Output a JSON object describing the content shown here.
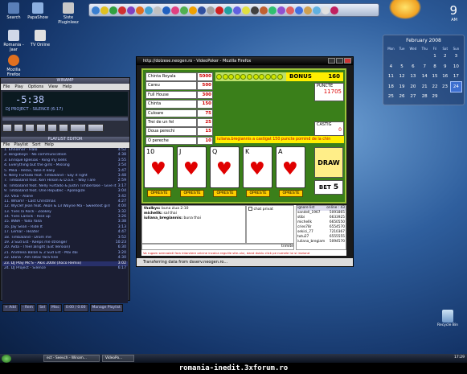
{
  "desktop_icons": [
    {
      "label": "Search",
      "color": "#5a7fb8"
    },
    {
      "label": "PapaShow",
      "color": "#8cb0e0"
    },
    {
      "label": "Siste Pluginleez",
      "color": "#c8c8c8"
    },
    {
      "label": "Romania - Jaar",
      "color": "#d0d8e8"
    },
    {
      "label": "TV Online",
      "color": "#e0e0e0"
    },
    {
      "label": "Mozilla Firefox",
      "color": "#e07020"
    }
  ],
  "clock": {
    "time": "9",
    "ampm": "AM"
  },
  "calendar": {
    "month": "February 2008",
    "days_header": [
      "Mon",
      "Tue",
      "Wed",
      "Thu",
      "Fri",
      "Sat",
      "Sun"
    ],
    "weeks": [
      [
        "",
        "",
        "",
        "",
        "1",
        "2",
        "3"
      ],
      [
        "4",
        "5",
        "6",
        "7",
        "8",
        "9",
        "10"
      ],
      [
        "11",
        "12",
        "13",
        "14",
        "15",
        "16",
        "17"
      ],
      [
        "18",
        "19",
        "20",
        "21",
        "22",
        "23",
        "24"
      ],
      [
        "25",
        "26",
        "27",
        "28",
        "29",
        "",
        ""
      ]
    ],
    "today": "24"
  },
  "winamp": {
    "title": "WINAMP",
    "menu": [
      "File",
      "Play",
      "Options",
      "View",
      "Help"
    ],
    "time": "-5:38",
    "song": "DJ PROJECT - SILENCE (6:17)",
    "playlist_title": "PLAYLIST EDITOR",
    "playlist_menu": [
      "File",
      "Playlist",
      "Sort",
      "Help"
    ],
    "tracks": [
      {
        "title": "1. Ehnomor - Halo",
        "dur": "4:52"
      },
      {
        "title": "2. Bingoboys - No communication",
        "dur": "4:38"
      },
      {
        "title": "3. Enrique Iglesias - Ring my bells",
        "dur": "3:55"
      },
      {
        "title": "4. Everything but the girls - Missing",
        "dur": "3:54"
      },
      {
        "title": "5. Mika - Relax, take it easy",
        "dur": "3:47"
      },
      {
        "title": "6. Nelly Furtado feat. Timbaland - Say it right",
        "dur": "3:48"
      },
      {
        "title": "7. Timbaland feat. Keri Hilson & D.o.e. - Way I are",
        "dur": "2:59"
      },
      {
        "title": "8. Timbaland feat. Nelly Furtado & Justin Timberlake - Give it...",
        "dur": "3:17"
      },
      {
        "title": "9. Timbaland feat. One Republic - Apologize",
        "dur": "3:04"
      },
      {
        "title": "10. Vika - Alane",
        "dur": "3:42"
      },
      {
        "title": "11. Wham! - Last Christmas",
        "dur": "4:27"
      },
      {
        "title": "12. Wyclef Jean feat. Akon & Lil Wayne Ma - Sweetest girl",
        "dur": "4:00"
      },
      {
        "title": "13. Yves la Rock - Zookey",
        "dur": "3:32"
      },
      {
        "title": "14. Yves Larock - Rise up",
        "dur": "3:26"
      },
      {
        "title": "15. INNA - Yalla Yalla",
        "dur": "3:38"
      },
      {
        "title": "16. Jay Sean - Ride It",
        "dur": "3:13"
      },
      {
        "title": "17. Lemar - Heater",
        "dur": "4:47"
      },
      {
        "title": "18. Timbaland - Drom me",
        "dur": "3:52"
      },
      {
        "title": "19. 3 Sud Est - Keeps me stronger",
        "dur": "10:23"
      },
      {
        "title": "20. Aida - I feel alright (Ext Version)",
        "dur": "6:30"
      },
      {
        "title": "21. Andreea Balan & 3 Sud Est - Mai dai",
        "dur": "3:20"
      },
      {
        "title": "22. Dana - Am ratac fara tine",
        "dur": "4:30"
      },
      {
        "title": "23. DJ Play Mc'S - Akis 2008 (Xoco Remix)",
        "dur": "3:02"
      },
      {
        "title": "24. DJ Project - Silence",
        "dur": "6:17"
      }
    ],
    "selected_index": 22,
    "playlist_buttons": [
      "+ Add",
      "- Rem",
      "Sel",
      "Misc",
      "0:00 / 0:00",
      "Manage Playlist"
    ]
  },
  "firefox": {
    "title": "http://dolzese.neogen.ro - VideoPoker - Mozilla Firefox",
    "status": "Transferring data from dsserv.neogen.ro..."
  },
  "game": {
    "paytable": [
      {
        "name": "Chinta Royala",
        "value": "5000"
      },
      {
        "name": "Careu",
        "value": "500"
      },
      {
        "name": "Full House",
        "value": "300"
      },
      {
        "name": "Chinta",
        "value": "150"
      },
      {
        "name": "Culoare",
        "value": "75"
      },
      {
        "name": "Trei de un fel",
        "value": "25"
      },
      {
        "name": "Doua perechi",
        "value": "15"
      },
      {
        "name": "O pereche",
        "value": "10"
      }
    ],
    "bonus_label": "BONUS",
    "bonus_value": "160",
    "puncte_label": "PUNCTE",
    "puncte_value": "11705",
    "castig_label": "CASTIG",
    "castig_value": "0",
    "win_message": "iuliana.bregiannis a castigat 150 puncte pornind de la chin",
    "cards": [
      {
        "rank": "10",
        "suit": "♥"
      },
      {
        "rank": "J",
        "suit": "♥"
      },
      {
        "rank": "Q",
        "suit": "♥"
      },
      {
        "rank": "K",
        "suit": "♥"
      },
      {
        "rank": "A",
        "suit": "♥"
      }
    ],
    "hold_label": "OPRESTE",
    "draw_label": "DRAW",
    "bet_label": "BET",
    "bet_value": "5"
  },
  "chat": {
    "messages": [
      {
        "who": "thalbys:",
        "text": "buna ziua 2:10"
      },
      {
        "who": "michellk:",
        "text": "sal thai"
      },
      {
        "who": "iuliana_bregiannis:",
        "text": "buna thai"
      }
    ],
    "private_label": "chat privat",
    "input_placeholder": "",
    "send_label": "trimite",
    "users_header_left": "ignore list",
    "users_header_right": "online : 43",
    "users": [
      {
        "name": "sandell_1967",
        "score": "5091865"
      },
      {
        "name": "stibi",
        "score": "6633925"
      },
      {
        "name": "michellk",
        "score": "6650550"
      },
      {
        "name": "cries78r",
        "score": "6554570"
      },
      {
        "name": "sekici_77",
        "score": "7210367"
      },
      {
        "name": "tutu27",
        "score": "6555555"
      },
      {
        "name": "iuliana_bregiam",
        "score": "5094570"
      }
    ],
    "warning": "Va rugam semnalati fara intarziere oricine incalca regulile site-ului, dand dublu click pe numele lui si iniziand"
  },
  "recycle_label": "Recycle Bin",
  "taskbar": {
    "items": [
      "ect - Seevch - Winam...",
      "VideoPo..."
    ],
    "tray_time": "17:29"
  },
  "watermark": "romania-inedit.3xforum.ro"
}
